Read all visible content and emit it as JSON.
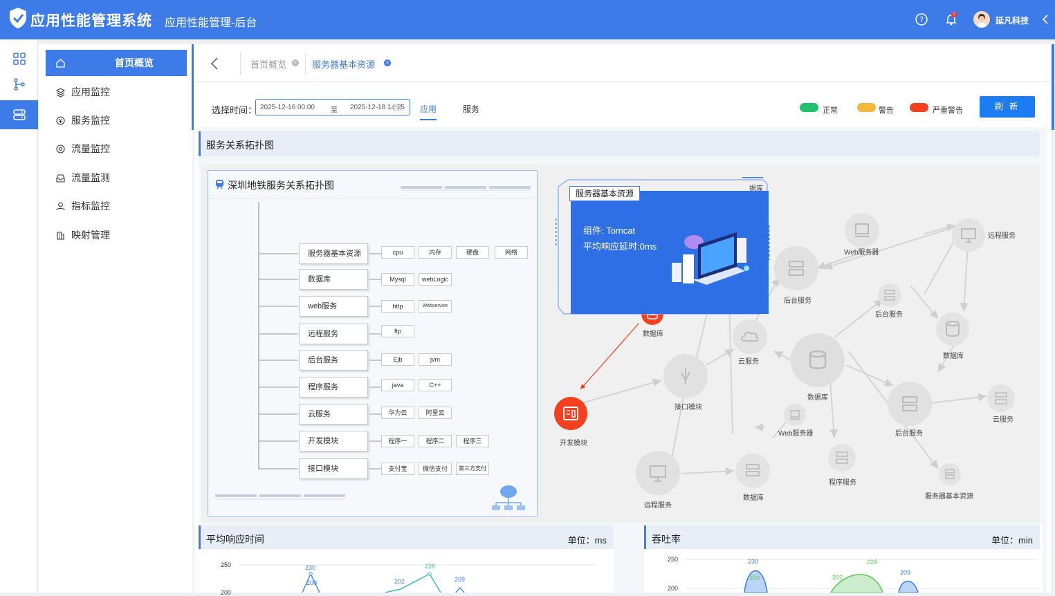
{
  "app": {
    "title": "应用性能管理系统",
    "subtitle": "应用性能管理-后台",
    "notify_count": "1",
    "user_name": "延凡科技"
  },
  "menu": {
    "items": [
      {
        "label": "首页概览",
        "icon": "home-icon"
      },
      {
        "label": "应用监控",
        "icon": "layers-icon"
      },
      {
        "label": "服务监控",
        "icon": "coin-icon"
      },
      {
        "label": "流量监控",
        "icon": "flow-icon"
      },
      {
        "label": "流量监测",
        "icon": "inbox-icon"
      },
      {
        "label": "指标监控",
        "icon": "user-icon"
      },
      {
        "label": "映射管理",
        "icon": "building-icon"
      }
    ]
  },
  "tabs": [
    {
      "label": "首页概览"
    },
    {
      "label": "服务器基本资源"
    }
  ],
  "filter": {
    "time_label": "选择时间：",
    "start": "2025-12-16 00:00",
    "to": "至",
    "end": "2025-12-18 14:25",
    "tab_app": "应用",
    "tab_service": "服务",
    "legend": [
      {
        "label": "正常",
        "color": "#1fc26b"
      },
      {
        "label": "警告",
        "color": "#f5b93a"
      },
      {
        "label": "严重警告",
        "color": "#f5401f"
      }
    ],
    "refresh": "刷 新"
  },
  "topology": {
    "section_title": "服务关系拓扑图",
    "tree_title": "深圳地铁服务关系拓扑图",
    "rows": [
      {
        "name": "服务器基本资源",
        "leaves": [
          "cpu",
          "内存",
          "硬盘",
          "网络"
        ]
      },
      {
        "name": "数据库",
        "leaves": [
          "Mysql",
          "webLogic"
        ]
      },
      {
        "name": "web服务",
        "leaves": [
          "http",
          "Webservice"
        ]
      },
      {
        "name": "远程服务",
        "leaves": [
          "ftp"
        ]
      },
      {
        "name": "后台服务",
        "leaves": [
          "Ejb",
          "jvm"
        ]
      },
      {
        "name": "程序服务",
        "leaves": [
          "java",
          "C++"
        ]
      },
      {
        "name": "云服务",
        "leaves": [
          "华为云",
          "阿里云"
        ]
      },
      {
        "name": "开发模块",
        "leaves": [
          "程序一",
          "程序二",
          "程序三"
        ]
      },
      {
        "name": "接口模块",
        "leaves": [
          "支付宝",
          "微信支付",
          "第三方支付"
        ]
      }
    ],
    "popup": {
      "title": "服务器基本资源",
      "component": "组件: Tomcat",
      "latency": "平均响应延时:0ms"
    },
    "graph_labels": {
      "n1": "数据库",
      "n2": "开发模块",
      "n3": "接口模块",
      "n4": "云服务",
      "n5": "后台服务",
      "n6": "Web服务器",
      "n7": "远程服务",
      "n8": "后台服务",
      "n9": "数据库",
      "n10": "数据库",
      "n11": "后台服务",
      "n12": "云服务",
      "n13": "Web服务器",
      "n14": "程序服务",
      "n15": "服务器基本资源",
      "n16": "远程服务",
      "n17": "数据库",
      "n18": "据库"
    }
  },
  "charts": [
    {
      "title": "平均响应时间",
      "unit": "单位：ms",
      "y_ticks": [
        "250",
        "200"
      ],
      "labels": [
        "230",
        "200",
        "202",
        "228",
        "209"
      ]
    },
    {
      "title": "吞吐率",
      "unit": "单位：min",
      "y_ticks": [
        "250",
        "200"
      ],
      "labels": [
        "230",
        "200",
        "202",
        "228",
        "209"
      ]
    }
  ]
}
